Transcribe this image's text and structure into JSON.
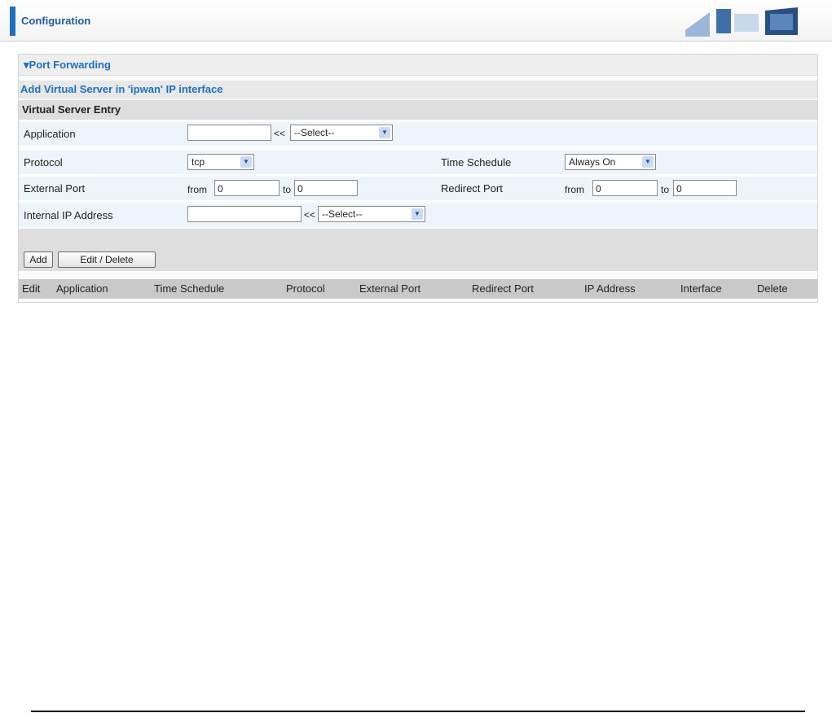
{
  "header": {
    "title": "Configuration"
  },
  "section": {
    "title": "▾Port Forwarding",
    "subtitle": "Add Virtual Server in 'ipwan' IP interface",
    "entry_header": "Virtual Server Entry"
  },
  "form": {
    "application_label": "Application",
    "application_value": "",
    "application_select": "--Select--",
    "protocol_label": "Protocol",
    "protocol_value": "tcp",
    "time_schedule_label": "Time Schedule",
    "time_schedule_value": "Always On",
    "external_port_label": "External Port",
    "ext_from_label": "from",
    "ext_from_value": "0",
    "ext_to_label": "to",
    "ext_to_value": "0",
    "redirect_port_label": "Redirect Port",
    "red_from_label": "from",
    "red_from_value": "0",
    "red_to_label": "to",
    "red_to_value": "0",
    "internal_ip_label": "Internal IP Address",
    "internal_ip_value": "",
    "internal_ip_select": "--Select--",
    "arrows": "<<"
  },
  "buttons": {
    "add": "Add",
    "edit_delete": "Edit / Delete"
  },
  "table": {
    "headers": [
      "Edit",
      "Application",
      "Time Schedule",
      "Protocol",
      "External Port",
      "Redirect Port",
      "IP Address",
      "Interface",
      "Delete"
    ]
  },
  "colors": {
    "accent": "#1f6fbf",
    "row_bg": "#eef4fb",
    "header_bg": "#c9c9c9"
  }
}
